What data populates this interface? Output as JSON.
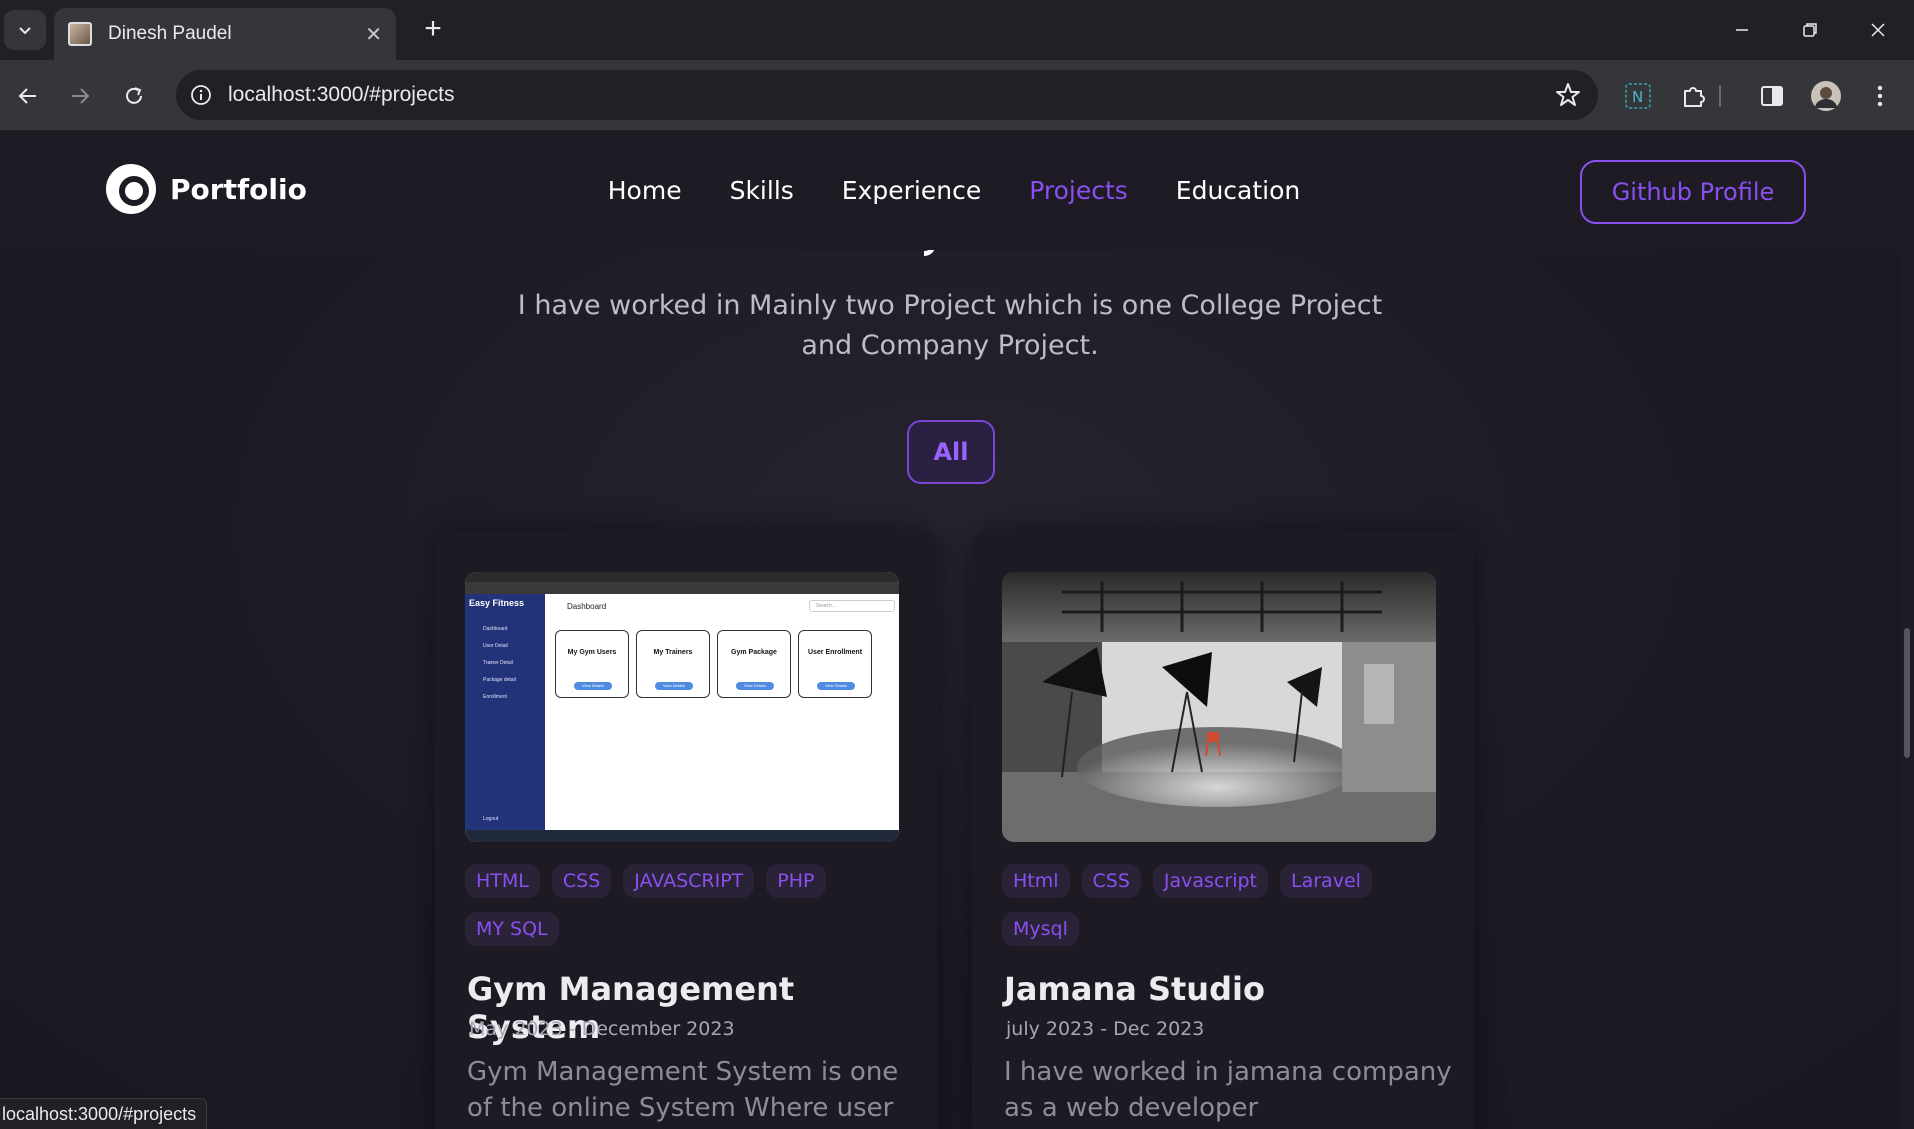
{
  "browser": {
    "tab_title": "Dinesh Paudel",
    "tab_close": "✕",
    "new_tab": "+",
    "url": "localhost:3000/#projects",
    "status_url": "localhost:3000/#projects",
    "window_controls": {
      "minimize": "—",
      "restore": "❐",
      "close": "✕"
    }
  },
  "site": {
    "logo_text": "Portfolio",
    "nav": [
      {
        "label": "Home",
        "active": false
      },
      {
        "label": "Skills",
        "active": false
      },
      {
        "label": "Experience",
        "active": false
      },
      {
        "label": "Projects",
        "active": true
      },
      {
        "label": "Education",
        "active": false
      }
    ],
    "github_button": "Github Profile",
    "accent_color": "#8a50ef"
  },
  "projects_section": {
    "intro": "I have worked in Mainly two Project which is one College Project and Company Project.",
    "filter_label": "All",
    "cards": [
      {
        "tags": [
          "HTML",
          "CSS",
          "JAVASCRIPT",
          "PHP",
          "MY SQL"
        ],
        "title": "Gym Management System",
        "date": "May 2023 - December 2023",
        "description": "Gym Management System is one of the online System Where user and",
        "image": {
          "brand": "Easy Fitness",
          "dashboard_label": "Dashboard",
          "search_placeholder": "Search...",
          "menu": [
            "Dashboard",
            "User Detail",
            "Trainer Detail",
            "Package detail",
            "Enrollment"
          ],
          "logout": "Logout",
          "boxes": [
            "My Gym Users",
            "My Trainers",
            "Gym Package",
            "User Enrollment"
          ],
          "box_button": "View Details"
        }
      },
      {
        "tags": [
          "Html",
          "CSS",
          "Javascript",
          "Laravel",
          "Mysql"
        ],
        "title": "Jamana Studio",
        "date": "july 2023 - Dec 2023",
        "description": "I have worked in jamana company as a web developer",
        "image": {
          "subject": "photo-studio"
        }
      }
    ]
  }
}
